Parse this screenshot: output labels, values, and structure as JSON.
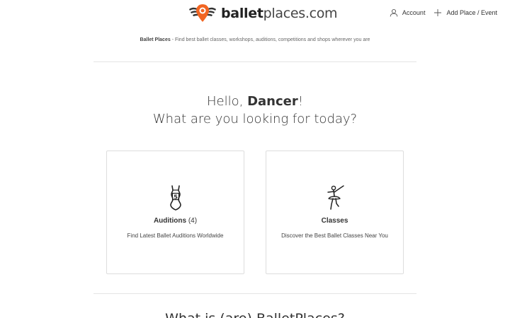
{
  "header": {
    "logo": {
      "bold": "ballet",
      "light": "places.com"
    },
    "nav": {
      "account_label": "Account",
      "add_label": "Add Place / Event"
    }
  },
  "tagline": {
    "brand": "Ballet Places",
    "text": " - Find best ballet classes, workshops, auditions, competitions and shops wherever you are"
  },
  "greeting": {
    "hello": "Hello, ",
    "name": "Dancer",
    "exclaim": "!",
    "question": "What are you looking for today?"
  },
  "cards": {
    "auditions": {
      "title": "Auditions",
      "count": " (4)",
      "description": "Find Latest Ballet Auditions Worldwide",
      "icon": "leotard-number-5-icon"
    },
    "classes": {
      "title": "Classes",
      "description": "Discover the Best Ballet Classes Near You",
      "icon": "ballerina-icon"
    }
  },
  "section": {
    "title": "What is (are) BalletPlaces?"
  },
  "colors": {
    "brand_orange": "#f26522",
    "text": "#333333",
    "border": "#dddddd"
  }
}
